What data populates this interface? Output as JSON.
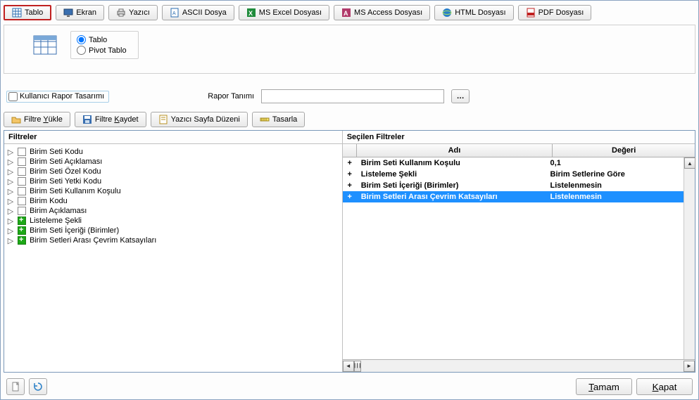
{
  "toolbar": [
    {
      "id": "tablo",
      "label": "Tablo",
      "icon": "table"
    },
    {
      "id": "ekran",
      "label": "Ekran",
      "icon": "screen"
    },
    {
      "id": "yazici",
      "label": "Yazıcı",
      "icon": "printer"
    },
    {
      "id": "ascii",
      "label": "ASCII Dosya",
      "icon": "ascii"
    },
    {
      "id": "excel",
      "label": "MS Excel Dosyası",
      "icon": "excel"
    },
    {
      "id": "access",
      "label": "MS Access Dosyası",
      "icon": "access"
    },
    {
      "id": "html",
      "label": "HTML Dosyası",
      "icon": "html"
    },
    {
      "id": "pdf",
      "label": "PDF Dosyası",
      "icon": "pdf"
    }
  ],
  "viewmode": {
    "tablo": "Tablo",
    "pivot": "Pivot Tablo",
    "selected": "tablo"
  },
  "userDesign": {
    "label": "Kullanıcı Rapor Tasarımı",
    "checked": false
  },
  "raporTanimi": {
    "label": "Rapor Tanımı",
    "value": ""
  },
  "filterbar": {
    "yukle": "Filtre Yükle",
    "kaydet": "Filtre Kaydet",
    "sayfa": "Yazıcı Sayfa Düzeni",
    "tasarla": "Tasarla"
  },
  "panes": {
    "left": "Filtreler",
    "right": "Seçilen Filtreler"
  },
  "filters": [
    {
      "label": "Birim Seti Kodu",
      "status": "empty"
    },
    {
      "label": "Birim Seti Açıklaması",
      "status": "empty"
    },
    {
      "label": "Birim Seti Özel Kodu",
      "status": "empty"
    },
    {
      "label": "Birim Seti Yetki Kodu",
      "status": "empty"
    },
    {
      "label": "Birim Seti Kullanım Koşulu",
      "status": "empty"
    },
    {
      "label": "Birim Kodu",
      "status": "empty"
    },
    {
      "label": "Birim Açıklaması",
      "status": "empty"
    },
    {
      "label": "Listeleme Şekli",
      "status": "green"
    },
    {
      "label": "Birim Seti İçeriği (Birimler)",
      "status": "green"
    },
    {
      "label": "Birim Setleri Arası Çevrim Katsayıları",
      "status": "green"
    }
  ],
  "gridHeaders": {
    "name": "Adı",
    "value": "Değeri"
  },
  "selectedFilters": [
    {
      "name": "Birim Seti Kullanım Koşulu",
      "value": "0,1",
      "sel": false
    },
    {
      "name": "Listeleme Şekli",
      "value": "Birim Setlerine Göre",
      "sel": false
    },
    {
      "name": "Birim Seti İçeriği (Birimler)",
      "value": "Listelenmesin",
      "sel": false
    },
    {
      "name": "Birim Setleri Arası Çevrim Katsayıları",
      "value": "Listelenmesin",
      "sel": true
    }
  ],
  "footerButtons": {
    "ok": "Tamam",
    "close": "Kapat"
  }
}
